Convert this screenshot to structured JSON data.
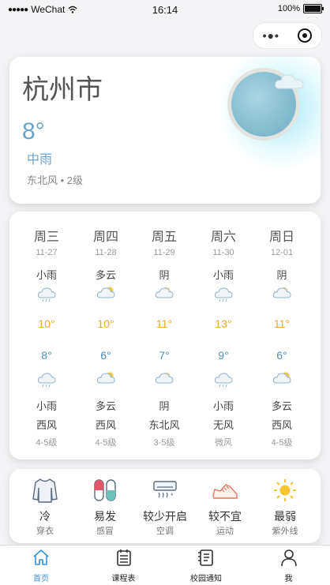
{
  "status_bar": {
    "signal": "●●●●●",
    "carrier": "WeChat",
    "time": "16:14",
    "battery": "100%"
  },
  "capsule": {
    "more": "•●•"
  },
  "current": {
    "city": "杭州市",
    "temp": "8°",
    "condition": "中雨",
    "wind": "东北风 • 2级"
  },
  "forecast": [
    {
      "day": "周三",
      "date": "11-27",
      "day_cond": "小雨",
      "high": "10°",
      "low": "8°",
      "night_cond": "小雨",
      "wind_dir": "西风",
      "wind_level": "4-5级",
      "icon_day": "light-rain",
      "icon_night": "light-rain"
    },
    {
      "day": "周四",
      "date": "11-28",
      "day_cond": "多云",
      "high": "10°",
      "low": "6°",
      "night_cond": "多云",
      "wind_dir": "西风",
      "wind_level": "4-5级",
      "icon_day": "partly-cloudy",
      "icon_night": "partly-cloudy"
    },
    {
      "day": "周五",
      "date": "11-29",
      "day_cond": "阴",
      "high": "11°",
      "low": "7°",
      "night_cond": "阴",
      "wind_dir": "东北风",
      "wind_level": "3-5级",
      "icon_day": "overcast",
      "icon_night": "overcast"
    },
    {
      "day": "周六",
      "date": "11-30",
      "day_cond": "小雨",
      "high": "13°",
      "low": "9°",
      "night_cond": "小雨",
      "wind_dir": "无风",
      "wind_level": "微风",
      "icon_day": "light-rain",
      "icon_night": "light-rain"
    },
    {
      "day": "周日",
      "date": "12-01",
      "day_cond": "阴",
      "high": "11°",
      "low": "6°",
      "night_cond": "多云",
      "wind_dir": "西风",
      "wind_level": "4-5级",
      "icon_day": "overcast",
      "icon_night": "partly-cloudy"
    }
  ],
  "life_index": [
    {
      "icon": "clothing-icon",
      "value": "冷",
      "label": "穿衣"
    },
    {
      "icon": "pill-icon",
      "value": "易发",
      "label": "感冒"
    },
    {
      "icon": "air-conditioner-icon",
      "value": "较少开启",
      "label": "空调"
    },
    {
      "icon": "sneaker-icon",
      "value": "较不宜",
      "label": "运动"
    },
    {
      "icon": "sun-icon",
      "value": "最弱",
      "label": "紫外线"
    }
  ],
  "tabbar": [
    {
      "label": "首页",
      "icon": "home-icon",
      "active": true
    },
    {
      "label": "课程表",
      "icon": "schedule-icon",
      "active": false
    },
    {
      "label": "校园通知",
      "icon": "notice-icon",
      "active": false
    },
    {
      "label": "我",
      "icon": "user-icon",
      "active": false
    }
  ],
  "colors": {
    "accent": "#3a8fd8",
    "high_temp": "#f0a82a",
    "low_temp": "#4b8fc0",
    "current_temp": "#6ba3c8"
  }
}
